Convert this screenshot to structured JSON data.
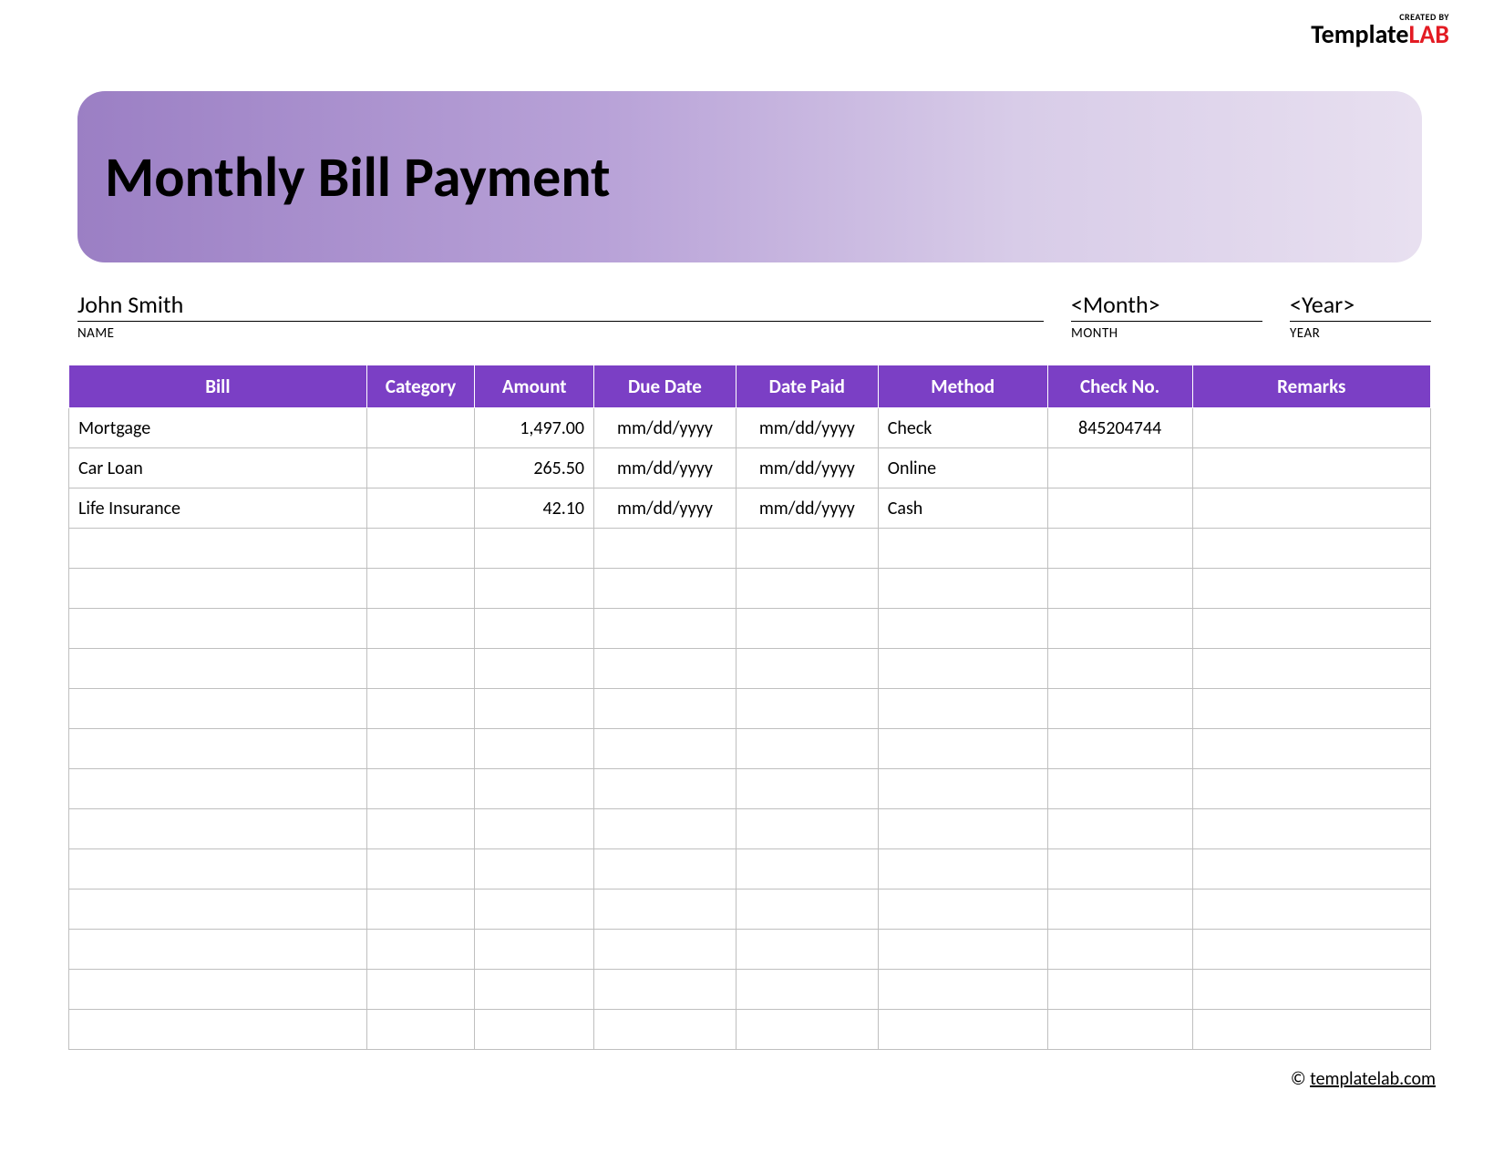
{
  "logo": {
    "created_by": "CREATED BY",
    "brand_main": "Template",
    "brand_accent": "LAB"
  },
  "header": {
    "title": "Monthly Bill Payment"
  },
  "meta": {
    "name_value": "John Smith",
    "name_label": "NAME",
    "month_value": "<Month>",
    "month_label": "MONTH",
    "year_value": "<Year>",
    "year_label": "YEAR"
  },
  "table": {
    "headers": {
      "bill": "Bill",
      "category": "Category",
      "amount": "Amount",
      "due_date": "Due Date",
      "date_paid": "Date Paid",
      "method": "Method",
      "check_no": "Check No.",
      "remarks": "Remarks"
    },
    "rows": [
      {
        "bill": "Mortgage",
        "category": "",
        "amount": "1,497.00",
        "due_date": "mm/dd/yyyy",
        "date_paid": "mm/dd/yyyy",
        "method": "Check",
        "check_no": "845204744",
        "remarks": ""
      },
      {
        "bill": "Car Loan",
        "category": "",
        "amount": "265.50",
        "due_date": "mm/dd/yyyy",
        "date_paid": "mm/dd/yyyy",
        "method": "Online",
        "check_no": "",
        "remarks": ""
      },
      {
        "bill": "Life Insurance",
        "category": "",
        "amount": "42.10",
        "due_date": "mm/dd/yyyy",
        "date_paid": "mm/dd/yyyy",
        "method": "Cash",
        "check_no": "",
        "remarks": ""
      },
      {
        "bill": "",
        "category": "",
        "amount": "",
        "due_date": "",
        "date_paid": "",
        "method": "",
        "check_no": "",
        "remarks": ""
      },
      {
        "bill": "",
        "category": "",
        "amount": "",
        "due_date": "",
        "date_paid": "",
        "method": "",
        "check_no": "",
        "remarks": ""
      },
      {
        "bill": "",
        "category": "",
        "amount": "",
        "due_date": "",
        "date_paid": "",
        "method": "",
        "check_no": "",
        "remarks": ""
      },
      {
        "bill": "",
        "category": "",
        "amount": "",
        "due_date": "",
        "date_paid": "",
        "method": "",
        "check_no": "",
        "remarks": ""
      },
      {
        "bill": "",
        "category": "",
        "amount": "",
        "due_date": "",
        "date_paid": "",
        "method": "",
        "check_no": "",
        "remarks": ""
      },
      {
        "bill": "",
        "category": "",
        "amount": "",
        "due_date": "",
        "date_paid": "",
        "method": "",
        "check_no": "",
        "remarks": ""
      },
      {
        "bill": "",
        "category": "",
        "amount": "",
        "due_date": "",
        "date_paid": "",
        "method": "",
        "check_no": "",
        "remarks": ""
      },
      {
        "bill": "",
        "category": "",
        "amount": "",
        "due_date": "",
        "date_paid": "",
        "method": "",
        "check_no": "",
        "remarks": ""
      },
      {
        "bill": "",
        "category": "",
        "amount": "",
        "due_date": "",
        "date_paid": "",
        "method": "",
        "check_no": "",
        "remarks": ""
      },
      {
        "bill": "",
        "category": "",
        "amount": "",
        "due_date": "",
        "date_paid": "",
        "method": "",
        "check_no": "",
        "remarks": ""
      },
      {
        "bill": "",
        "category": "",
        "amount": "",
        "due_date": "",
        "date_paid": "",
        "method": "",
        "check_no": "",
        "remarks": ""
      },
      {
        "bill": "",
        "category": "",
        "amount": "",
        "due_date": "",
        "date_paid": "",
        "method": "",
        "check_no": "",
        "remarks": ""
      },
      {
        "bill": "",
        "category": "",
        "amount": "",
        "due_date": "",
        "date_paid": "",
        "method": "",
        "check_no": "",
        "remarks": ""
      }
    ]
  },
  "footer": {
    "copy_symbol": "©",
    "link_text": "templatelab.com"
  }
}
